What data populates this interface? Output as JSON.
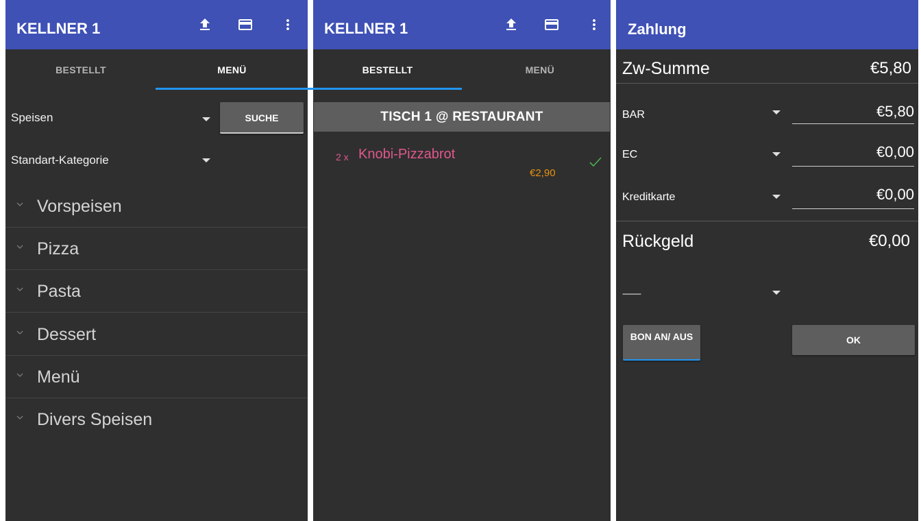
{
  "colors": {
    "appbar": "#3f51b5",
    "background": "#2f2f2f",
    "tab_indicator": "#2196f3",
    "order_item": "#e0578c",
    "order_price": "#e8920f",
    "check": "#4caf50",
    "button": "#5e5e5e"
  },
  "screen1": {
    "title": "KELLNER 1",
    "icons": [
      "upload-icon",
      "credit-card-icon",
      "more-vert-icon"
    ],
    "tabs": [
      {
        "label": "BESTELLT",
        "active": false
      },
      {
        "label": "MENÜ",
        "active": true
      }
    ],
    "spinner_type": "Speisen",
    "search_button": "SUCHE",
    "spinner_category": "Standart-Kategorie",
    "categories": [
      "Vorspeisen",
      "Pizza",
      "Pasta",
      "Dessert",
      "Menü",
      "Divers Speisen"
    ]
  },
  "screen2": {
    "title": "KELLNER 1",
    "icons": [
      "upload-icon",
      "credit-card-icon",
      "more-vert-icon"
    ],
    "tabs": [
      {
        "label": "BESTELLT",
        "active": true
      },
      {
        "label": "MENÜ",
        "active": false
      }
    ],
    "table_header": "TISCH  1 @ RESTAURANT",
    "order": {
      "qty": "2 x",
      "name": "Knobi-Pizzabrot",
      "price": "€2,90",
      "status_icon": "check-icon"
    }
  },
  "screen3": {
    "title": "Zahlung",
    "subtotal_label": "Zw-Summe",
    "subtotal_value": "€5,80",
    "methods": [
      {
        "label": "BAR",
        "value": "€5,80"
      },
      {
        "label": "EC",
        "value": "€0,00"
      },
      {
        "label": "Kreditkarte",
        "value": "€0,00"
      }
    ],
    "change_label": "Rückgeld",
    "change_value": "€0,00",
    "extra_spinner": "---------",
    "bon_button": "BON AN/ AUS",
    "ok_button": "OK"
  }
}
